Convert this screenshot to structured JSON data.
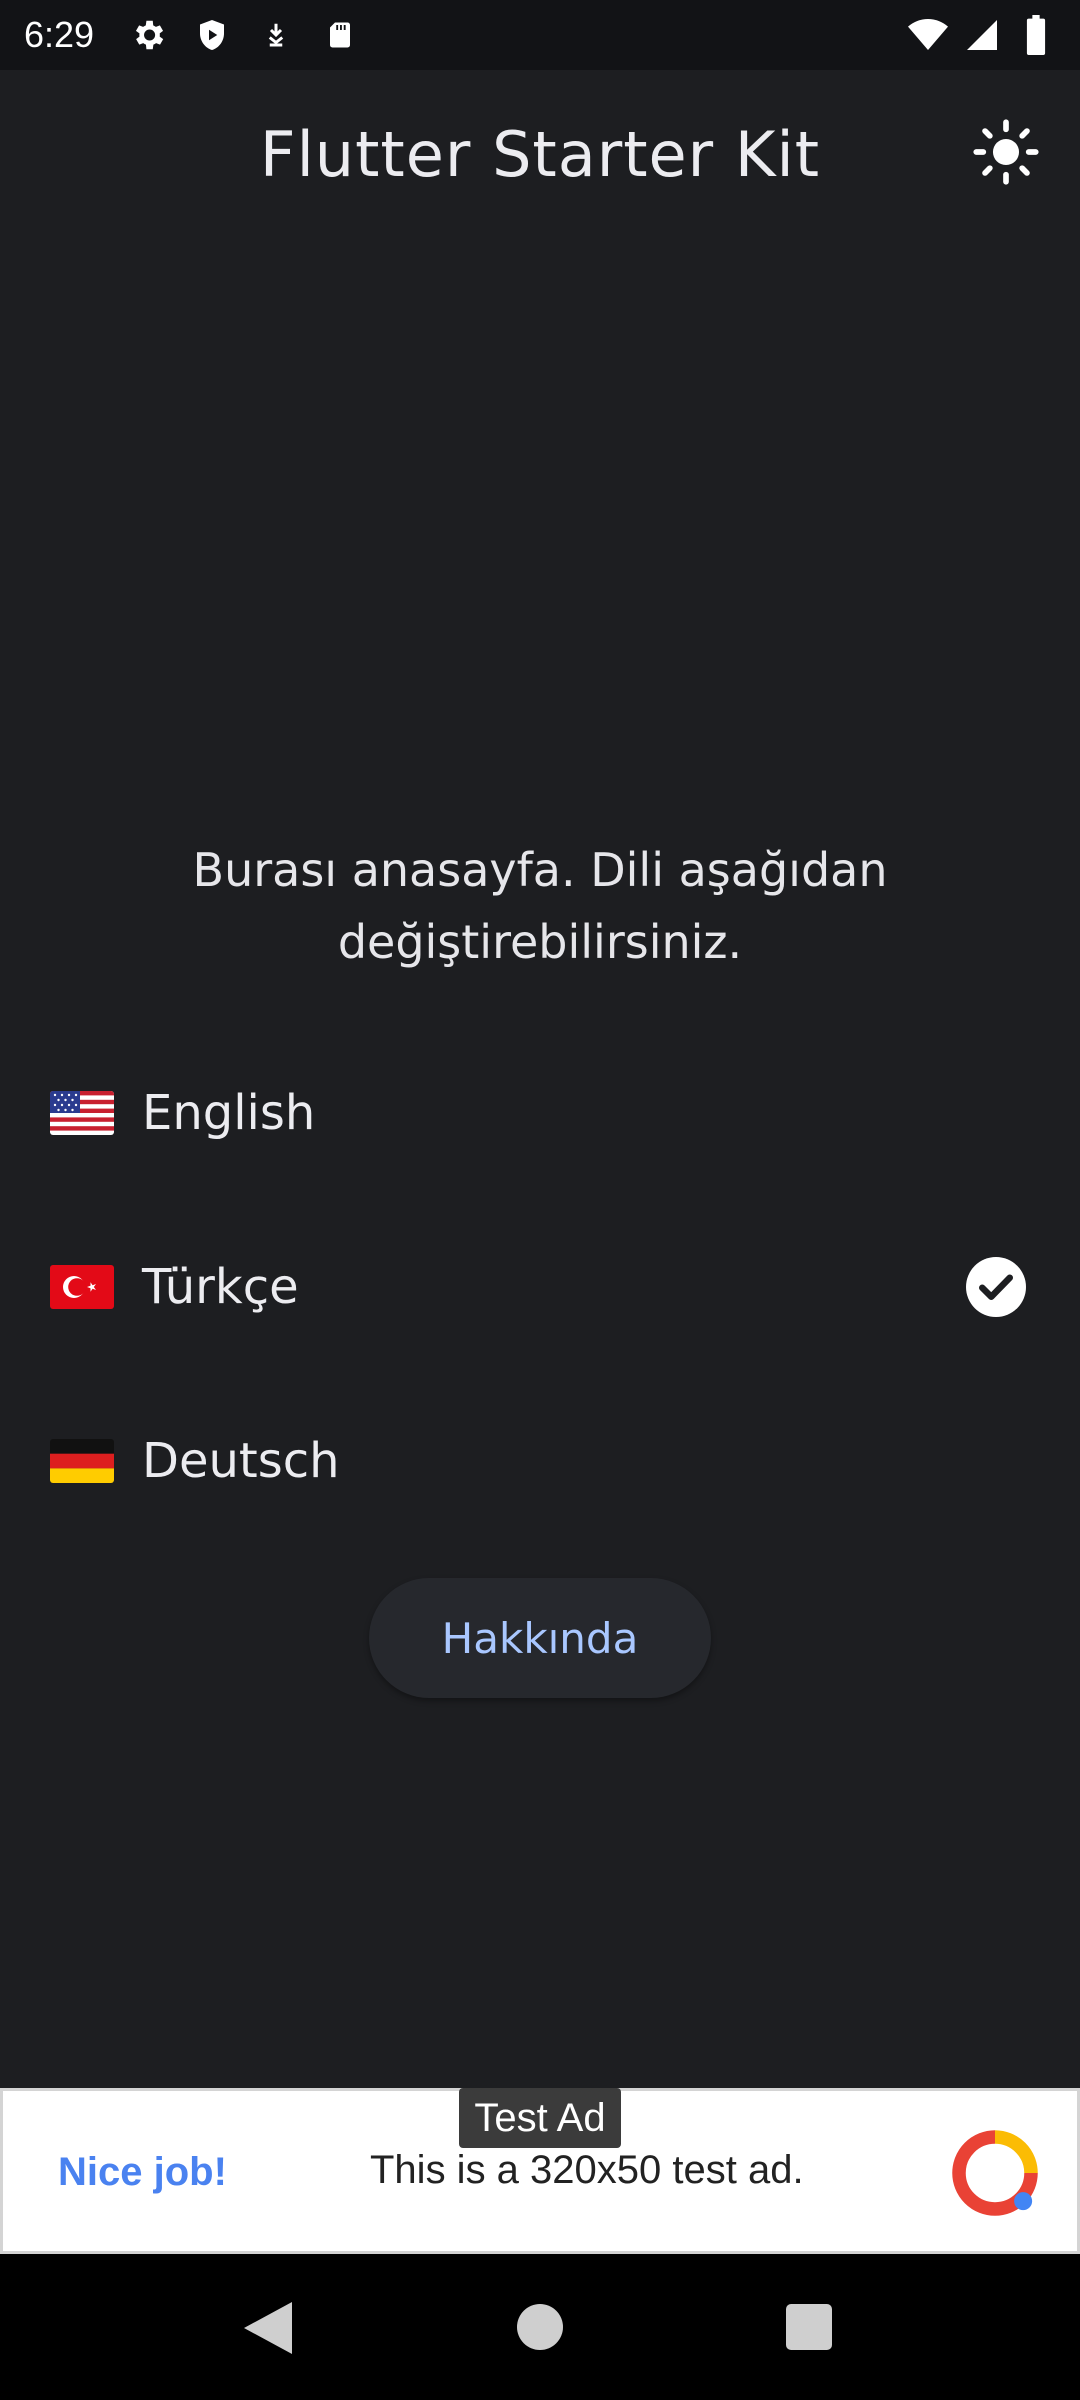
{
  "status_bar": {
    "time": "6:29",
    "left_icons": [
      "settings-icon",
      "shield-play-icon",
      "download-icon",
      "sd-card-icon"
    ],
    "right_icons": [
      "wifi-icon",
      "signal-icon",
      "battery-icon"
    ]
  },
  "app_bar": {
    "title": "Flutter Starter Kit",
    "theme_toggle_icon": "sun-icon"
  },
  "home": {
    "message": "Burası anasayfa. Dili aşağıdan değiştirebilirsiniz."
  },
  "languages": [
    {
      "label": "English",
      "flag": "flag-us-icon",
      "selected": false
    },
    {
      "label": "Türkçe",
      "flag": "flag-tr-icon",
      "selected": true
    },
    {
      "label": "Deutsch",
      "flag": "flag-de-icon",
      "selected": false
    }
  ],
  "about_button": {
    "label": "Hakkında"
  },
  "ad": {
    "tag": "Test Ad",
    "headline": "Nice job!",
    "body": "This is a 320x50 test ad."
  },
  "colors": {
    "background": "#1d1e21",
    "accent": "#a9c7ff",
    "ad_headline": "#4a82f0"
  }
}
